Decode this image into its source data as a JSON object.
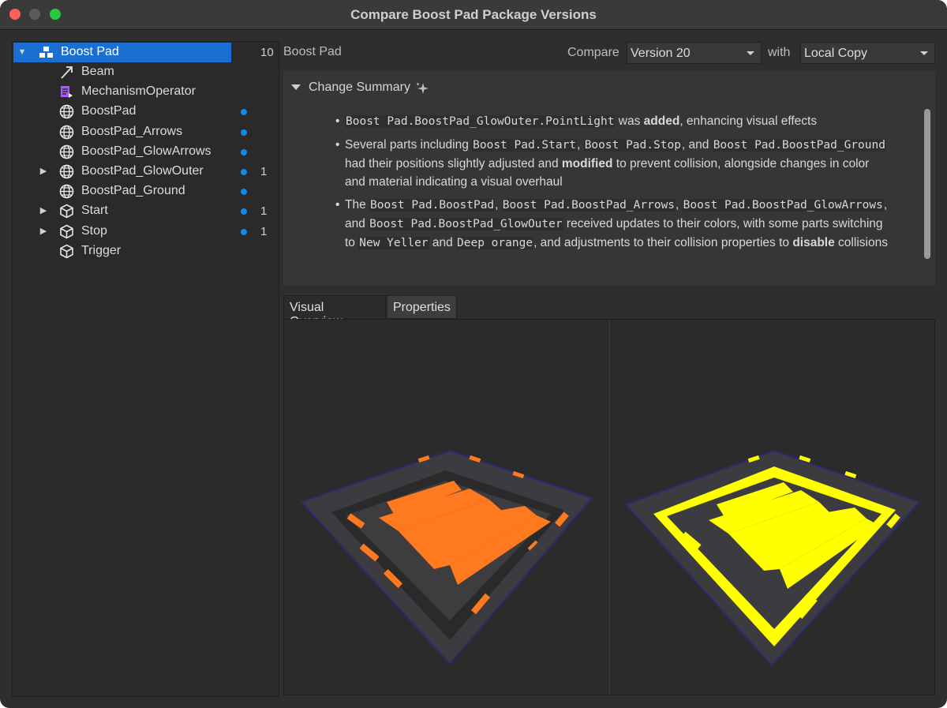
{
  "window": {
    "title": "Compare Boost Pad Package Versions"
  },
  "colors": {
    "selection": "#1b6fd1",
    "change_dot": "#0f8be6",
    "orange_accent": "#ff7a1f",
    "yellow_accent": "#ffff00",
    "mechanism_icon": "#a55bff"
  },
  "tree": {
    "root": {
      "label": "Boost Pad",
      "count": "10",
      "icon": "package-icon"
    },
    "items": [
      {
        "label": "Beam",
        "icon": "beam-icon",
        "expandable": false,
        "changed": false,
        "count": ""
      },
      {
        "label": "MechanismOperator",
        "icon": "script-icon",
        "expandable": false,
        "changed": false,
        "count": ""
      },
      {
        "label": "BoostPad",
        "icon": "mesh-globe-icon",
        "expandable": false,
        "changed": true,
        "count": ""
      },
      {
        "label": "BoostPad_Arrows",
        "icon": "mesh-globe-icon",
        "expandable": false,
        "changed": true,
        "count": ""
      },
      {
        "label": "BoostPad_GlowArrows",
        "icon": "mesh-globe-icon",
        "expandable": false,
        "changed": true,
        "count": ""
      },
      {
        "label": "BoostPad_GlowOuter",
        "icon": "mesh-globe-icon",
        "expandable": true,
        "changed": true,
        "count": "1"
      },
      {
        "label": "BoostPad_Ground",
        "icon": "mesh-globe-icon",
        "expandable": false,
        "changed": true,
        "count": ""
      },
      {
        "label": "Start",
        "icon": "part-cube-icon",
        "expandable": true,
        "changed": true,
        "count": "1"
      },
      {
        "label": "Stop",
        "icon": "part-cube-icon",
        "expandable": true,
        "changed": true,
        "count": "1"
      },
      {
        "label": "Trigger",
        "icon": "part-cube-icon",
        "expandable": false,
        "changed": false,
        "count": ""
      }
    ]
  },
  "header": {
    "name": "Boost Pad",
    "compare_label": "Compare",
    "compare_value": "Version 20",
    "with_label": "with",
    "with_value": "Local Copy"
  },
  "summary": {
    "title": "Change Summary",
    "b1": {
      "code1": "Boost Pad.BoostPad_GlowOuter.PointLight",
      "t1": " was ",
      "bold1": "added",
      "t2": ", enhancing visual effects"
    },
    "b2": {
      "t1": "Several parts including ",
      "code1": "Boost Pad.Start",
      "t2": ", ",
      "code2": "Boost Pad.Stop",
      "t3": ", and ",
      "code3": "Boost Pad.BoostPad_Ground",
      "t4": " had their positions slightly adjusted and ",
      "bold1": "modified",
      "t5": " to prevent collision, alongside changes in color and material indicating a visual overhaul"
    },
    "b3": {
      "t1": "The ",
      "code1": "Boost Pad.BoostPad",
      "t2": ", ",
      "code2": "Boost Pad.BoostPad_Arrows",
      "t3": ", ",
      "code3": "Boost Pad.BoostPad_GlowArrows",
      "t4": ", and ",
      "code4": "Boost Pad.BoostPad_GlowOuter",
      "t5": " received updates to their colors, with some parts switching to ",
      "code5": "New Yeller",
      "t6": " and ",
      "code6": "Deep orange",
      "t7": ", and adjustments to their collision properties to ",
      "bold1": "disable",
      "t8": " collisions"
    }
  },
  "tabs": [
    {
      "label": "Visual Overview",
      "active": true
    },
    {
      "label": "Properties",
      "active": false
    }
  ]
}
